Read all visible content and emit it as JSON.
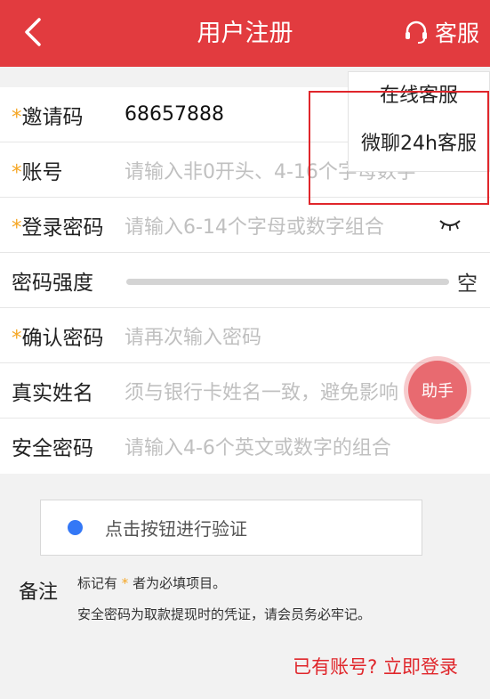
{
  "header": {
    "title": "用户注册",
    "service_label": "客服"
  },
  "service_menu": {
    "items": [
      "在线客服",
      "微聊24h客服"
    ]
  },
  "form": {
    "invite": {
      "label": "邀请码",
      "value": "68657888"
    },
    "account": {
      "label": "账号",
      "placeholder": "请输入非0开头、4-16个字母数字"
    },
    "password": {
      "label": "登录密码",
      "placeholder": "请输入6-14个字母或数字组合"
    },
    "strength": {
      "label": "密码强度",
      "text": "空",
      "level": 0
    },
    "confirm": {
      "label": "确认密码",
      "placeholder": "请再次输入密码"
    },
    "realname": {
      "label": "真实姓名",
      "placeholder": "须与银行卡姓名一致，避免影响"
    },
    "safe_password": {
      "label": "安全密码",
      "placeholder": "请输入4-6个英文或数字的组合"
    },
    "required_mark": "*"
  },
  "helper_label": "助手",
  "verify": {
    "text": "点击按钮进行验证"
  },
  "notes": {
    "title": "备注",
    "line1_prefix": "标记有",
    "line1_suffix": "者为必填项目。",
    "line2": "安全密码为取款提现时的凭证，请会员务必牢记。"
  },
  "login_link": "已有账号? 立即登录",
  "colors": {
    "brand": "#e23b3f",
    "required": "#f5a623",
    "verify_dot": "#3478f6"
  }
}
